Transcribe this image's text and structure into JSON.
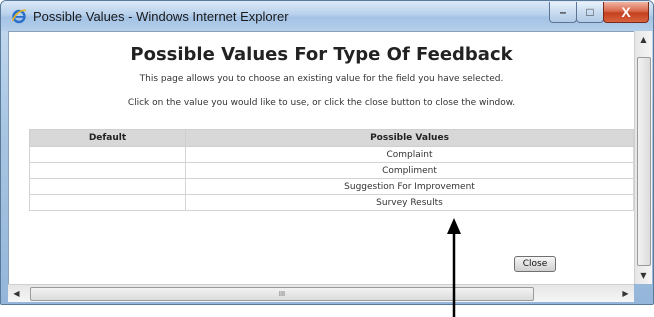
{
  "window": {
    "title": "Possible Values - Windows Internet Explorer",
    "controls": {
      "minimize": "–",
      "maximize": "□",
      "close": "X"
    }
  },
  "page": {
    "heading": "Possible Values For Type Of Feedback",
    "description": "This page allows you to choose an existing value for the field you have selected.",
    "instructions": "Click on the value you would like to use, or click the close button to close the window."
  },
  "table": {
    "headers": [
      "Default",
      "Possible Values"
    ],
    "rows": [
      [
        "",
        "Complaint"
      ],
      [
        "",
        "Compliment"
      ],
      [
        "",
        "Suggestion For Improvement"
      ],
      [
        "",
        "Survey Results"
      ]
    ]
  },
  "buttons": {
    "close": "Close"
  },
  "scrollbars": {
    "up": "▲",
    "down": "▼",
    "left": "◀",
    "right": "▶",
    "grip": "III"
  },
  "colors": {
    "header_bg": "#d8d8d8",
    "title_bar": "#b8d1ec",
    "close_control": "#c4411f"
  },
  "icons": {
    "browser": "internet-explorer-icon",
    "annotation": "pointer-arrow"
  }
}
